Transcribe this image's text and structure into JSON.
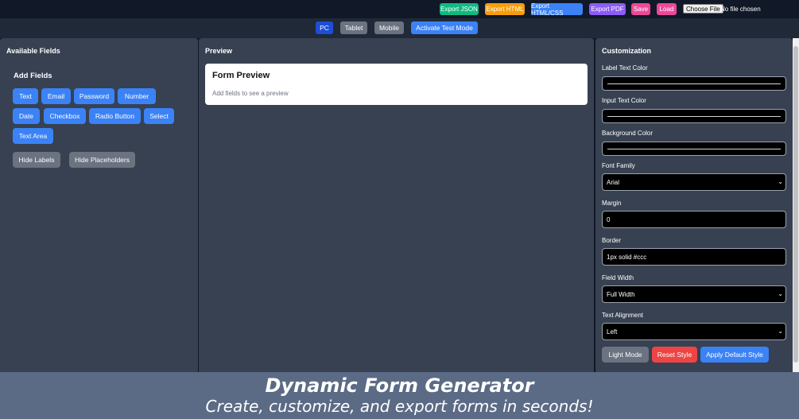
{
  "topbar": {
    "export_json": "Export JSON",
    "export_html": "Export HTML",
    "export_html_css": "Export HTML/CSS",
    "export_pdf": "Export PDF",
    "save": "Save",
    "load": "Load",
    "choose_file": "Choose File",
    "no_file": "No file chosen"
  },
  "devices": {
    "pc": "PC",
    "tablet": "Tablet",
    "mobile": "Mobile",
    "test_mode": "Activate Test Mode"
  },
  "left": {
    "title": "Available Fields",
    "add_fields": "Add Fields",
    "fields": [
      "Text",
      "Email",
      "Password",
      "Number",
      "Date",
      "Checkbox",
      "Radio Button",
      "Select",
      "Text Area"
    ],
    "hide_labels": "Hide Labels",
    "hide_placeholders": "Hide Placeholders"
  },
  "preview": {
    "title": "Preview",
    "card_title": "Form Preview",
    "empty_text": "Add fields to see a preview"
  },
  "custom": {
    "title": "Customization",
    "label_text_color": "Label Text Color",
    "input_text_color": "Input Text Color",
    "background_color": "Background Color",
    "font_family": "Font Family",
    "font_family_value": "Arial",
    "margin": "Margin",
    "margin_value": "0",
    "border": "Border",
    "border_value": "1px solid #ccc",
    "field_width": "Field Width",
    "field_width_value": "Full Width",
    "text_alignment": "Text Alignment",
    "text_alignment_value": "Left",
    "light_mode": "Light Mode",
    "reset_style": "Reset Style",
    "apply_default": "Apply Default Style"
  },
  "banner": {
    "title": "Dynamic Form Generator",
    "subtitle": "Create, customize, and export forms in seconds!"
  },
  "colors": {
    "green": "#10b981",
    "orange": "#f59e0b",
    "blue": "#3b82f6",
    "purple": "#8b5cf6",
    "pink": "#ec4899",
    "red": "#ef4444",
    "gray": "#6b7280",
    "active_blue": "#1d4ed8"
  }
}
